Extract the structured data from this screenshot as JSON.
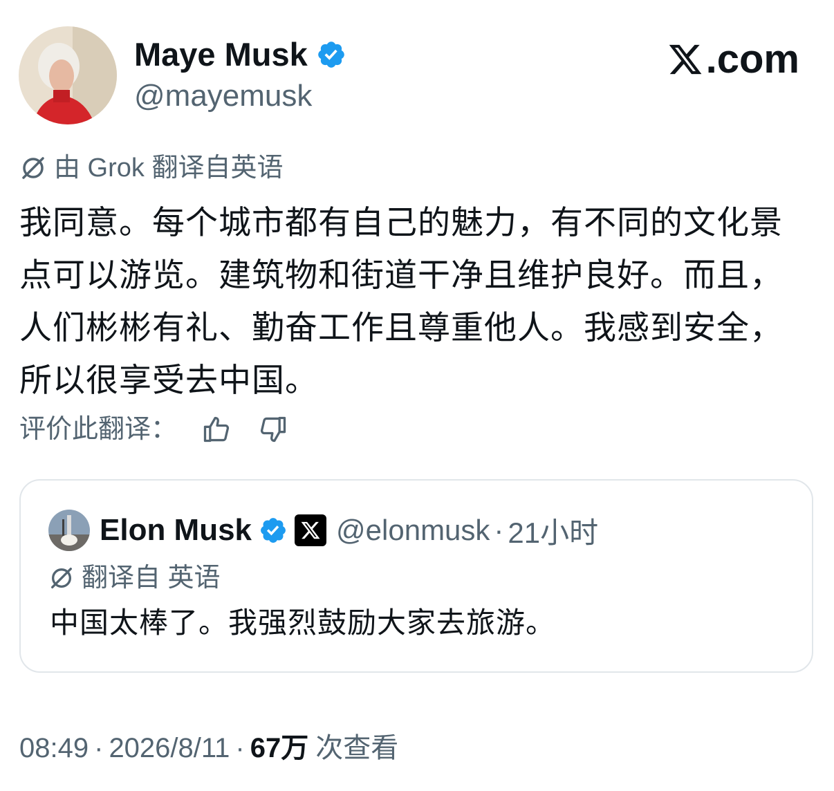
{
  "author": {
    "name": "Maye Musk",
    "handle": "@mayemusk"
  },
  "brand": {
    "label": ".com"
  },
  "translation": {
    "notice": "由 Grok 翻译自英语"
  },
  "tweet": {
    "text": "我同意。每个城市都有自己的魅力，有不同的文化景点可以游览。建筑物和街道干净且维护良好。而且，人们彬彬有礼、勤奋工作且尊重他人。我感到安全，所以很享受去中国。"
  },
  "rating": {
    "label": "评价此翻译："
  },
  "quote": {
    "name": "Elon Musk",
    "handle": "@elonmusk",
    "separator": "·",
    "time": "21小时",
    "translated_notice": "翻译自 英语",
    "text": "中国太棒了。我强烈鼓励大家去旅游。"
  },
  "meta": {
    "time": "08:49",
    "separator": "·",
    "date": "2026/8/11",
    "views_count": "67万",
    "views_label": "次查看"
  },
  "colors": {
    "verified_blue": "#1d9bf0",
    "secondary_text": "#536471",
    "primary_text": "#0f1419",
    "border": "#e1e6ea"
  }
}
